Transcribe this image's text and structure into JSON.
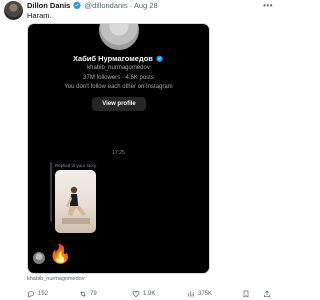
{
  "tweet": {
    "author_name": "Dillon Danis",
    "handle": "@dillondanis",
    "separator": "·",
    "date": "Aug 28",
    "text": "Haram."
  },
  "screenshot": {
    "profile_name": "Хабиб Нурмагомедов",
    "profile_handle": "khabib_nurmagomedov",
    "profile_stats": "37M followers · 4.6K posts",
    "follow_status": "You don't follow each other on Instagram",
    "view_profile_label": "View profile",
    "message_time": "17:25",
    "reply_label": "Replied to your story",
    "reaction": "🔥"
  },
  "caption": "khabib_nurmagomedov",
  "actions": {
    "replies": "192",
    "retweets": "79",
    "likes": "1.9K",
    "views": "375K"
  },
  "icons": {
    "verified": "verified-badge-icon",
    "more": "more-icon",
    "reply": "reply-icon",
    "retweet": "retweet-icon",
    "like": "heart-icon",
    "views": "views-icon",
    "bookmark": "bookmark-icon",
    "share": "share-icon"
  },
  "colors": {
    "verified": "#1d9bf0",
    "secondary_text": "#536471",
    "dm_background": "#000000"
  }
}
